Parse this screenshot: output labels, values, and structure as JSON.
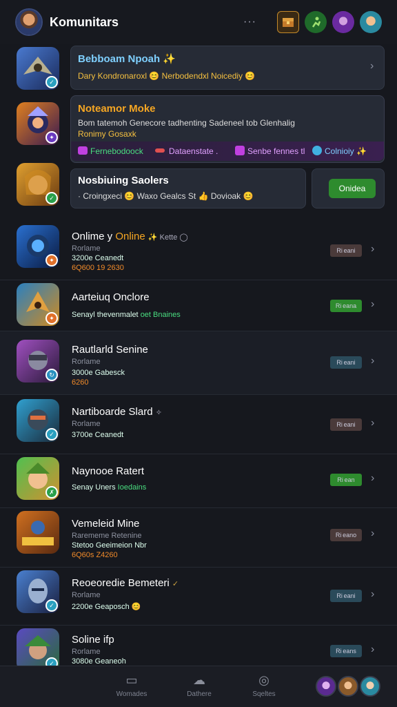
{
  "header": {
    "title": "Komunitars",
    "more_label": "···"
  },
  "featured": [
    {
      "title": "Bebboam Npoah ✨",
      "line1": "Dary Kondronaroxl 😊 Nerbodendxl Noicediy 😊"
    },
    {
      "title": "Noteamor Moke",
      "line1": "Bom tatemoh Genecore tadhenting Sadeneel tob Glenhalig",
      "line2": "Ronimy Gosaxk",
      "tags": [
        "Fernebodoock",
        "Dataenstate .",
        "Senbe fennes tl",
        "Colnioiy ✨"
      ]
    },
    {
      "title": "Nosbiuing Saolers",
      "line1": "· Croingxeci 😊 Waxo Gealcs St 👍 Dovioak 😊",
      "button": "Onidea"
    }
  ],
  "rows": [
    {
      "title": "Onlime y",
      "title_accent": "Online",
      "title_suffix": "✨ Kette ◯",
      "sub": "Rorlame",
      "meta": "3200e Ceanedt",
      "orange": "6Q600 19 2630",
      "status": "Ri eani"
    },
    {
      "title": "Aarteiuq Onclore",
      "sub": "",
      "meta": "Senayl thevenmalet",
      "green": "oet Bnaines",
      "status": "Ri eana"
    },
    {
      "title": "Rautlarld Senine",
      "sub": "Rorlame",
      "meta": "3000e Gabesck",
      "orange": "6260",
      "status": "Ri eani"
    },
    {
      "title": "Nartiboarde Slard",
      "title_suffix": "✧",
      "sub": "Rorlame",
      "meta": "3700e Ceanedt",
      "status": "Ri eani"
    },
    {
      "title": "Naynooe Ratert",
      "sub": "",
      "meta": "Senay Uners",
      "green": "Ioedains",
      "status": "Ri ean"
    },
    {
      "title": "Vemeleid Mine",
      "sub": "Rarememe Retenine",
      "meta": "Stetoo Geeimeion Nbr",
      "orange": "6Q60s Z4260",
      "status": "Ri eano"
    },
    {
      "title": "Reoeoredie Bemeteri",
      "title_suffix": "✓",
      "sub": "Rorlame",
      "meta": "2200e Geaposch 😊",
      "status": "Ri eani"
    },
    {
      "title": "Soline ifp",
      "sub": "Rorlame",
      "meta": "3080e Geaneoh",
      "status": "Ri eans"
    }
  ],
  "bottom_nav": [
    {
      "label": "Womades",
      "icon": "home-icon"
    },
    {
      "label": "Dathere",
      "icon": "community-icon"
    },
    {
      "label": "Sqeltes",
      "icon": "settings-icon"
    }
  ],
  "colors": {
    "green": "#2e8b2e",
    "orange": "#f08a2a",
    "blue_title": "#7fd0ff",
    "gold_title": "#f5a623"
  }
}
